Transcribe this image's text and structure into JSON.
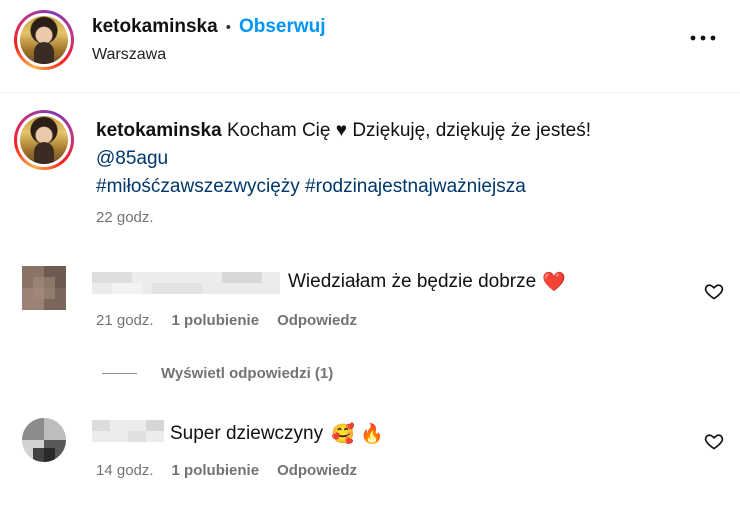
{
  "header": {
    "username": "ketokaminska",
    "separator": "•",
    "follow_label": "Obserwuj",
    "location": "Warszawa",
    "more_icon": "more-horizontal-icon"
  },
  "caption": {
    "username": "ketokaminska",
    "text": "Kocham Cię",
    "heart": "♥",
    "text_after": "Dziękuję, dziękuję że jesteś!",
    "mention": "@85agu",
    "hashtags": "#miłośćzawszezwycięży #rodzinajestnajważniejsza",
    "time": "22 godz."
  },
  "comments": [
    {
      "text": "Wiedziałam że będzie dobrze",
      "emoji": "❤️",
      "time": "21 godz.",
      "likes": "1 polubienie",
      "reply": "Odpowiedz"
    },
    {
      "text": "Super dziewczyny",
      "emoji": "🥰 🔥",
      "time": "14 godz.",
      "likes": "1 polubienie",
      "reply": "Odpowiedz"
    }
  ],
  "view_replies": "Wyświetl odpowiedzi (1)",
  "colors": {
    "follow": "#0095f6",
    "link": "#00376b",
    "muted": "#737373",
    "heart_red": "#ff3040"
  }
}
